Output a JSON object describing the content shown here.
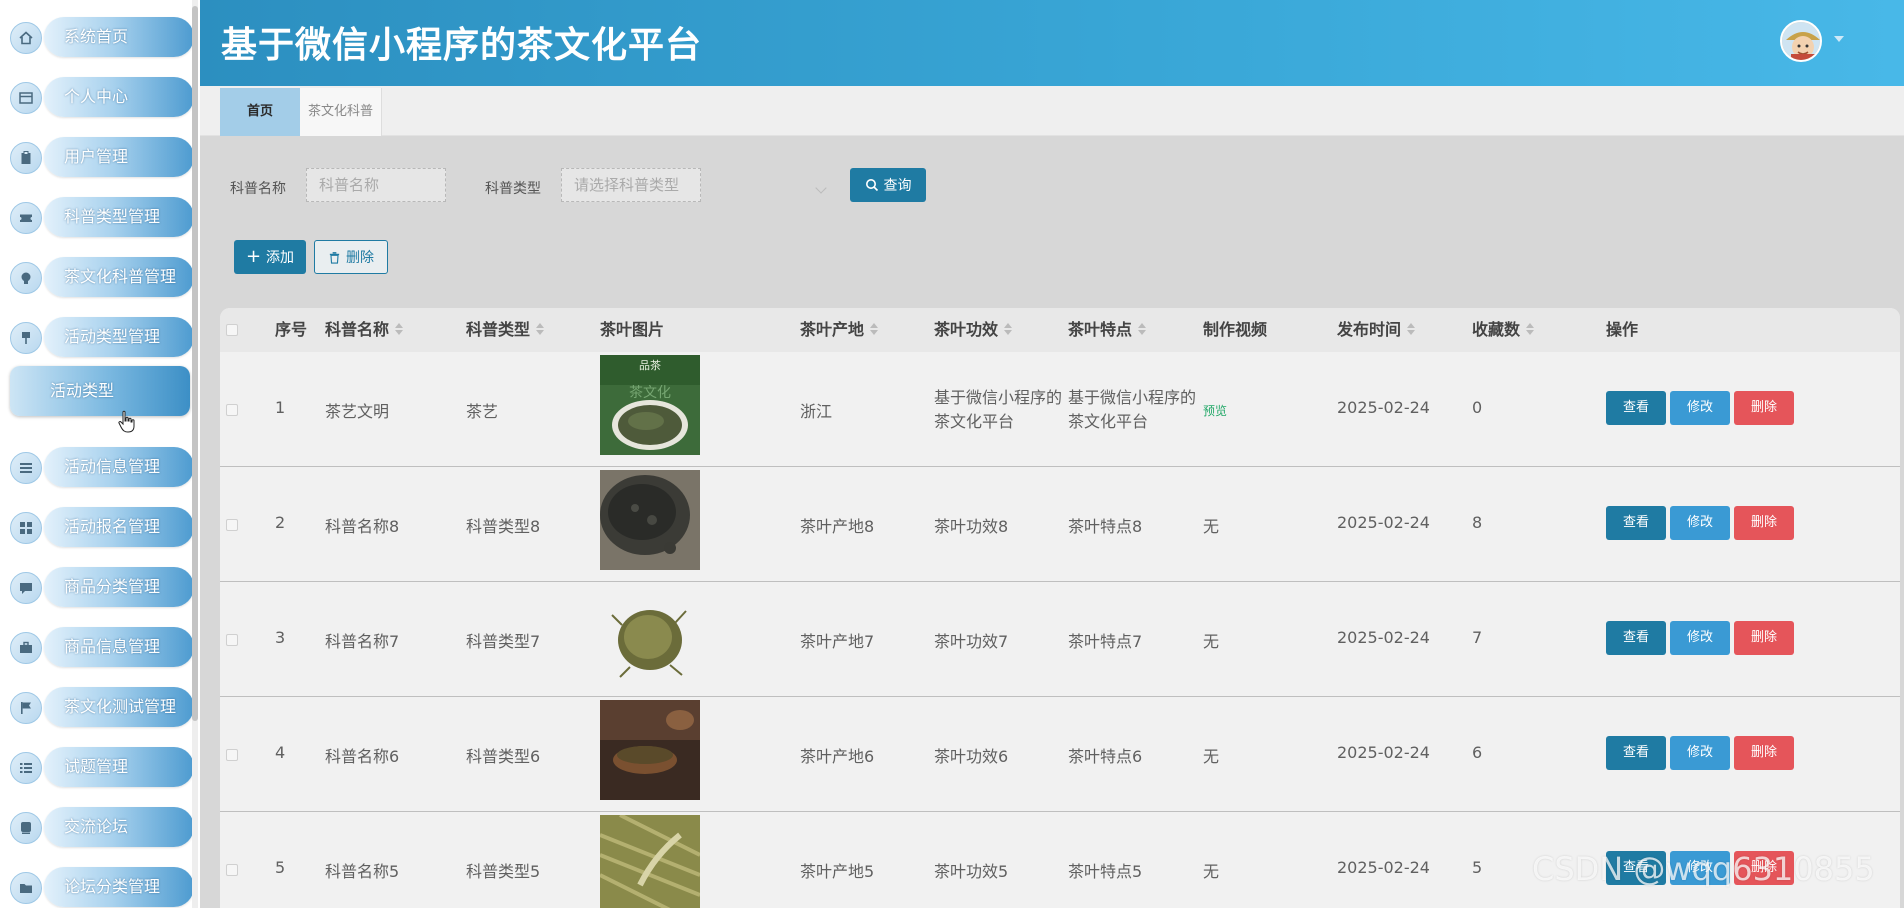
{
  "header": {
    "title": "基于微信小程序的茶文化平台"
  },
  "sidebar": {
    "items": [
      {
        "label": "系统首页",
        "icon": "home-icon"
      },
      {
        "label": "个人中心",
        "icon": "window-icon"
      },
      {
        "label": "用户管理",
        "icon": "clipboard-icon"
      },
      {
        "label": "科普类型管理",
        "icon": "ticket-icon"
      },
      {
        "label": "茶文化科普管理",
        "icon": "bulb-icon"
      },
      {
        "label": "活动类型管理",
        "icon": "pin-icon"
      },
      {
        "label": "活动信息管理",
        "icon": "list-icon"
      },
      {
        "label": "活动报名管理",
        "icon": "grid-icon"
      },
      {
        "label": "商品分类管理",
        "icon": "chat-icon"
      },
      {
        "label": "商品信息管理",
        "icon": "briefcase-icon"
      },
      {
        "label": "茶文化测试管理",
        "icon": "flag-icon"
      },
      {
        "label": "试题管理",
        "icon": "checklist-icon"
      },
      {
        "label": "交流论坛",
        "icon": "board-icon"
      },
      {
        "label": "论坛分类管理",
        "icon": "folder-icon"
      }
    ],
    "submenu": {
      "label": "活动类型"
    }
  },
  "tabs": [
    {
      "label": "首页"
    },
    {
      "label": "茶文化科普"
    }
  ],
  "search": {
    "name_label": "科普名称",
    "name_placeholder": "科普名称",
    "type_label": "科普类型",
    "type_placeholder": "请选择科普类型",
    "search_button": "查询"
  },
  "toolbar": {
    "add_label": "添加",
    "delete_label": "删除"
  },
  "table": {
    "columns": [
      "序号",
      "科普名称",
      "科普类型",
      "茶叶图片",
      "茶叶产地",
      "茶叶功效",
      "茶叶特点",
      "制作视频",
      "发布时间",
      "收藏数",
      "操作"
    ],
    "rows": [
      {
        "index": "1",
        "name": "茶艺文明",
        "type": "茶艺",
        "origin": "浙江",
        "effect": "基于微信小程序的茶文化平台",
        "feature": "基于微信小程序的茶文化平台",
        "video": "预览",
        "date": "2025-02-24",
        "favorites": "0"
      },
      {
        "index": "2",
        "name": "科普名称8",
        "type": "科普类型8",
        "origin": "茶叶产地8",
        "effect": "茶叶功效8",
        "feature": "茶叶特点8",
        "video": "无",
        "date": "2025-02-24",
        "favorites": "8"
      },
      {
        "index": "3",
        "name": "科普名称7",
        "type": "科普类型7",
        "origin": "茶叶产地7",
        "effect": "茶叶功效7",
        "feature": "茶叶特点7",
        "video": "无",
        "date": "2025-02-24",
        "favorites": "7"
      },
      {
        "index": "4",
        "name": "科普名称6",
        "type": "科普类型6",
        "origin": "茶叶产地6",
        "effect": "茶叶功效6",
        "feature": "茶叶特点6",
        "video": "无",
        "date": "2025-02-24",
        "favorites": "6"
      },
      {
        "index": "5",
        "name": "科普名称5",
        "type": "科普类型5",
        "origin": "茶叶产地5",
        "effect": "茶叶功效5",
        "feature": "茶叶特点5",
        "video": "无",
        "date": "2025-02-24",
        "favorites": "5"
      }
    ],
    "actions": {
      "view": "查看",
      "edit": "修改",
      "delete": "删除"
    }
  },
  "thumb_text": {
    "r1_top": "品茶",
    "r1_mid": "茶文化"
  },
  "watermark": "CSDN @wqq6310855",
  "colors": {
    "accent": "#1f7ba3",
    "edit": "#3a9ad4",
    "danger": "#e5555a",
    "header": "#3aa8d8"
  }
}
